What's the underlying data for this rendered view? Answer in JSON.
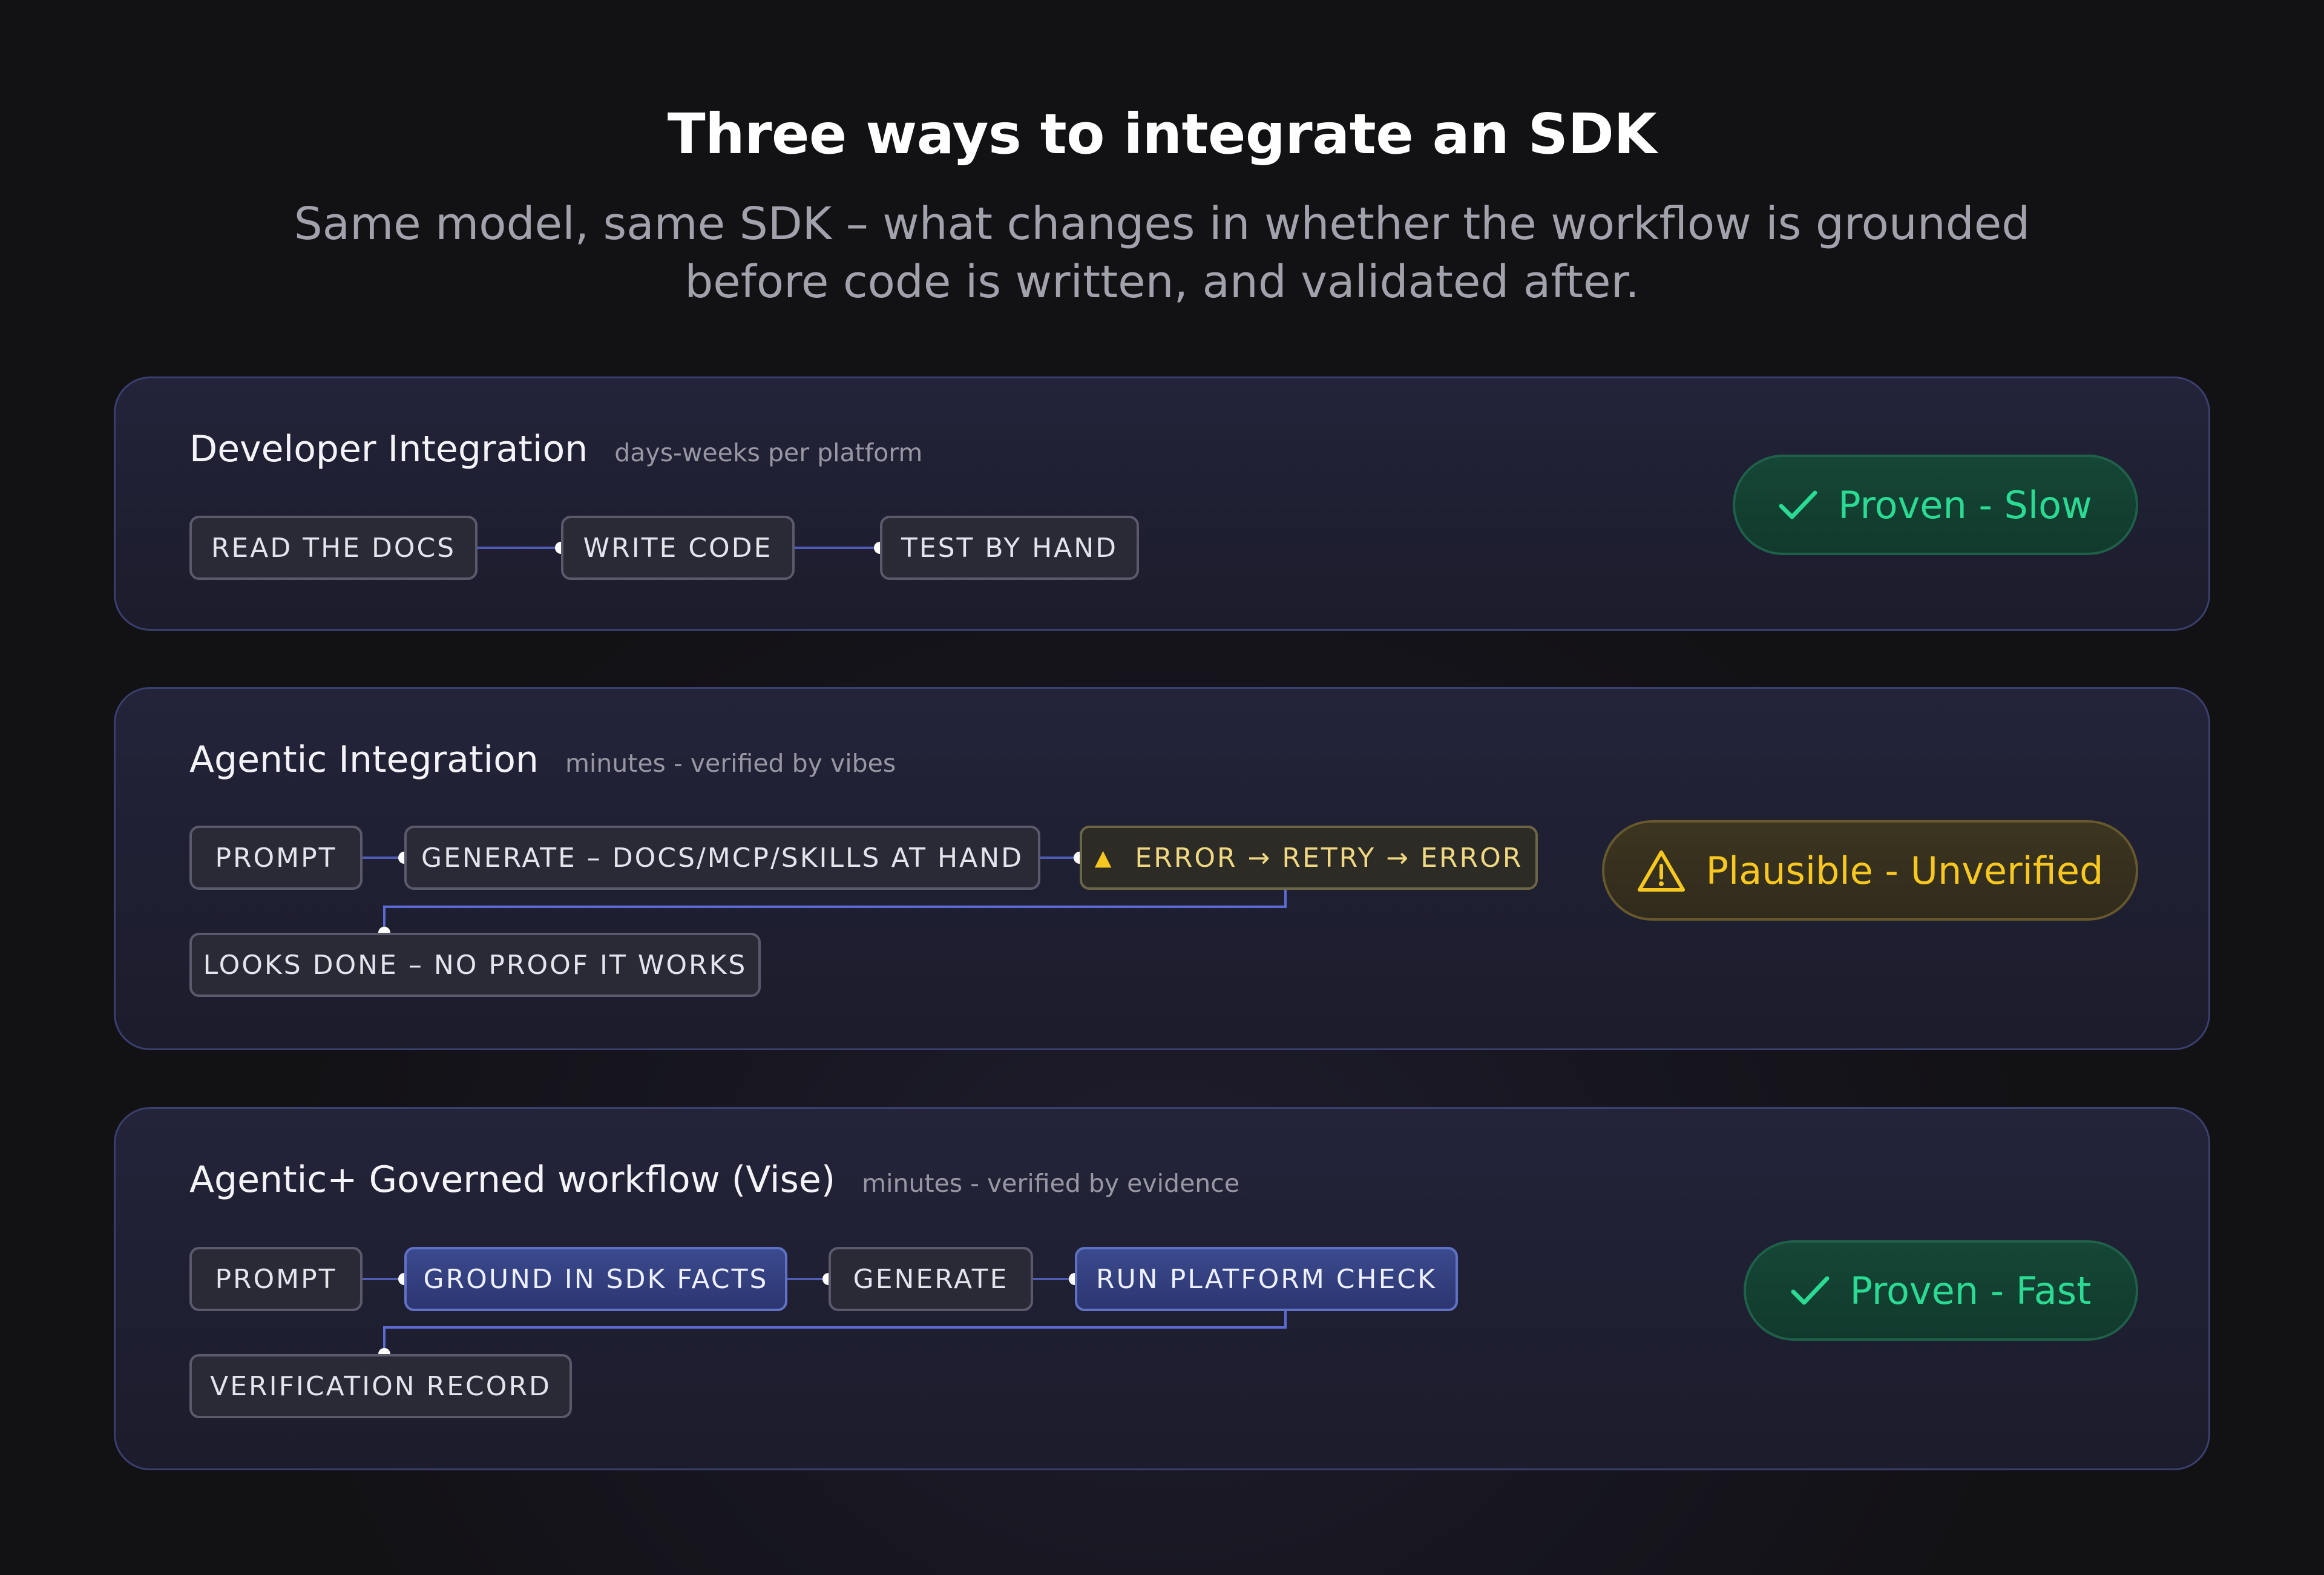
{
  "header": {
    "title": "Three ways to integrate an SDK",
    "subtitle_line1": "Same model, same SDK – what changes in whether the workflow is grounded",
    "subtitle_line2": "before code is written, and validated after."
  },
  "panels": [
    {
      "title": "Developer Integration",
      "meta": "days-weeks per platform",
      "steps": [
        "READ THE DOCS",
        "WRITE CODE",
        "TEST BY HAND"
      ],
      "badge": {
        "label": "Proven - Slow",
        "icon": "check-icon",
        "color": "#2bdb94"
      }
    },
    {
      "title": "Agentic Integration",
      "meta": "minutes - verified by vibes",
      "steps": [
        "PROMPT",
        "GENERATE – DOCS/MCP/SKILLS AT HAND",
        "ERROR → RETRY → ERROR",
        "LOOKS DONE – NO PROOF IT WORKS"
      ],
      "badge": {
        "label": "Plausible - Unverified",
        "icon": "warning-icon",
        "color": "#f9c820"
      }
    },
    {
      "title": "Agentic+ Governed workflow (Vise)",
      "meta": "minutes - verified by evidence",
      "steps": [
        "PROMPT",
        "GROUND IN SDK FACTS",
        "GENERATE",
        "RUN PLATFORM CHECK",
        "VERIFICATION RECORD"
      ],
      "badge": {
        "label": "Proven - Fast",
        "icon": "check-icon",
        "color": "#2bdb94"
      }
    }
  ],
  "colors": {
    "connector": "#5c6bd4",
    "highlight_step": "#3b4a8e",
    "warning": "#f6c623",
    "success": "#2bdb94"
  }
}
